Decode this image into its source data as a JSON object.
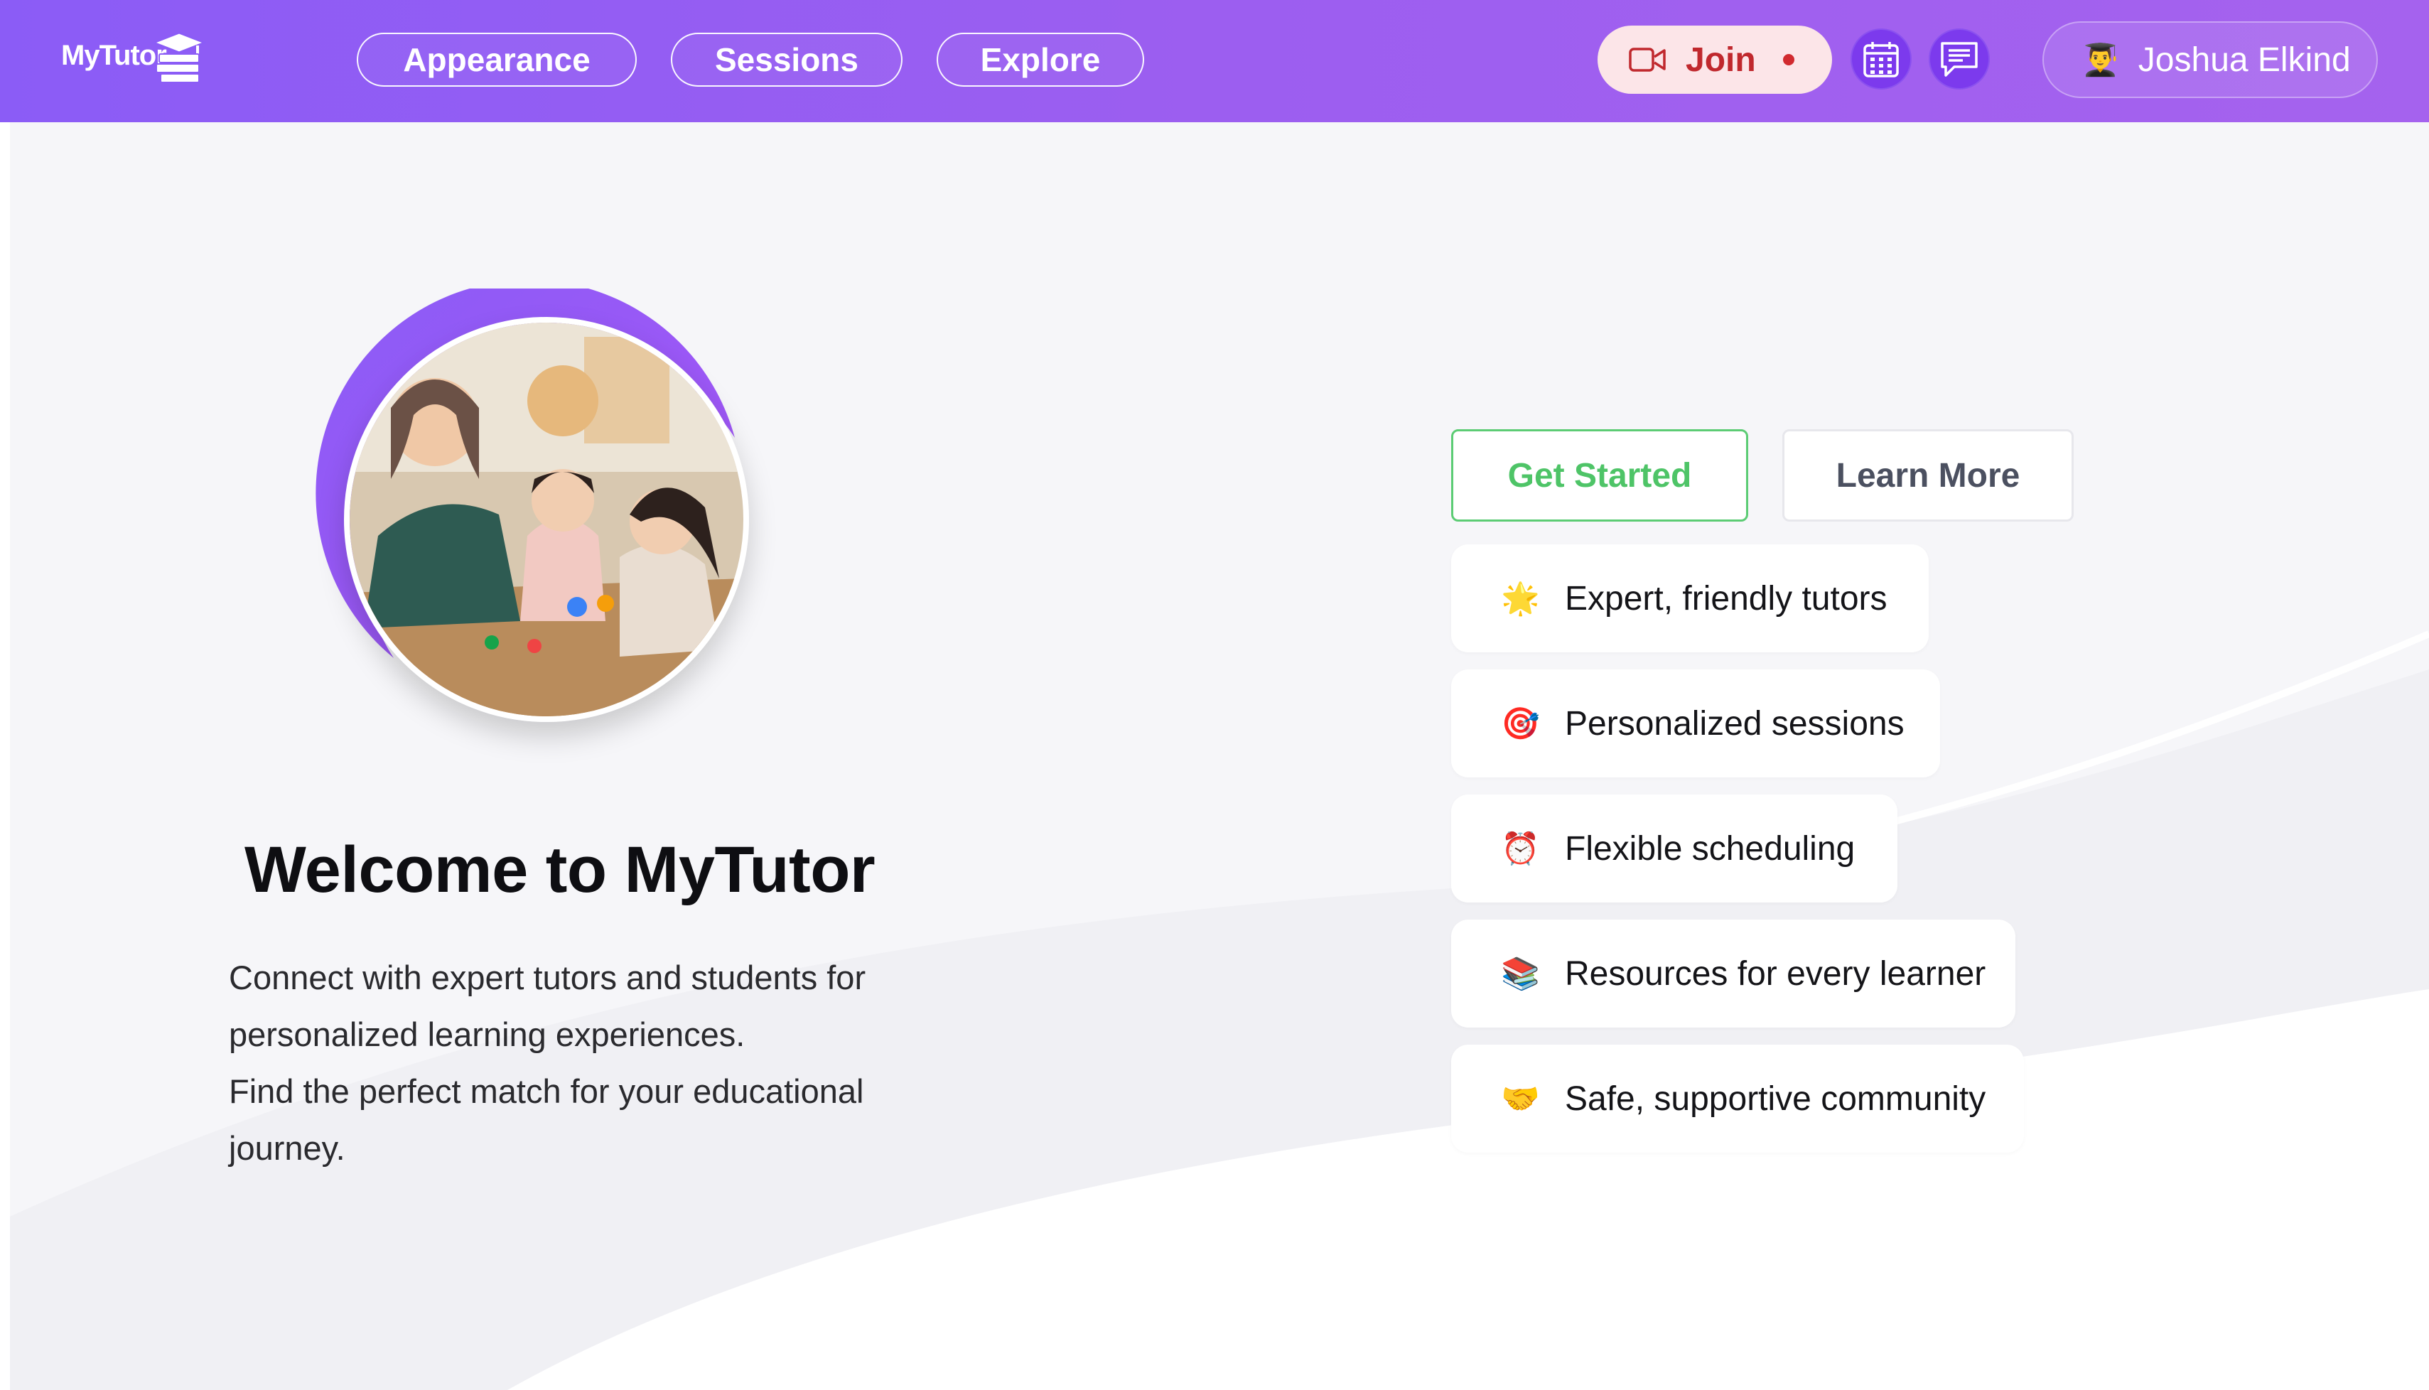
{
  "header": {
    "logo_text": "MyTutor",
    "nav": [
      "Appearance",
      "Sessions",
      "Explore"
    ],
    "join_label": "Join",
    "user_name": "Joshua Elkind",
    "user_emoji": "👨‍🎓"
  },
  "hero": {
    "title": "Welcome to MyTutor",
    "description_lines": [
      "Connect with expert tutors and students for",
      "personalized learning experiences.",
      "Find the perfect match for your educational",
      "journey."
    ]
  },
  "actions": {
    "get_started": "Get Started",
    "learn_more": "Learn More"
  },
  "features": [
    {
      "icon": "🌟",
      "label": "Expert, friendly tutors"
    },
    {
      "icon": "🎯",
      "label": "Personalized sessions"
    },
    {
      "icon": "⏰",
      "label": "Flexible scheduling"
    },
    {
      "icon": "📚",
      "label": "Resources for every learner"
    },
    {
      "icon": "🤝",
      "label": "Safe, supportive community"
    }
  ],
  "colors": {
    "header_gradient_start": "#8b5cf6",
    "header_gradient_end": "#a562ee",
    "join_bg": "#fce5e8",
    "join_text": "#c0282d",
    "primary_green": "#4ec467",
    "icon_button_bg": "#7c3aed"
  },
  "icons": {
    "logo": "graduation-books-icon",
    "join": "video-camera-icon",
    "calendar": "calendar-icon",
    "messages": "chat-bubble-icon"
  }
}
